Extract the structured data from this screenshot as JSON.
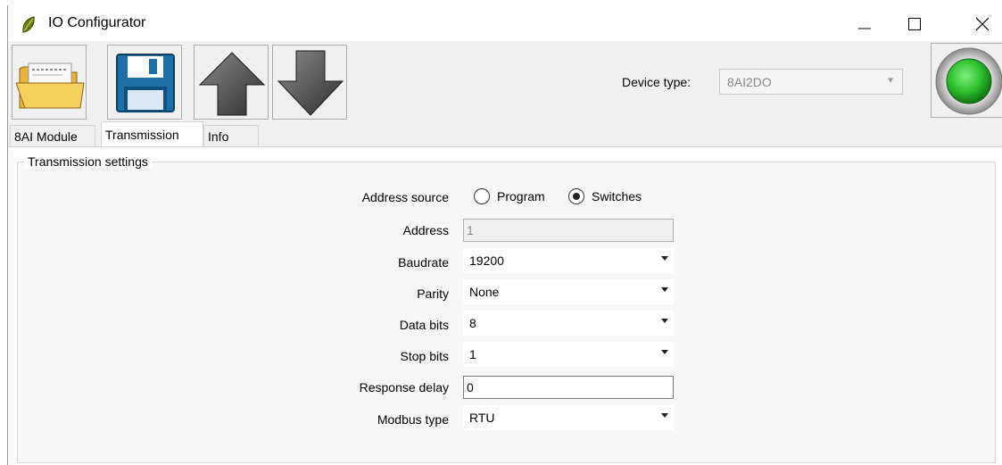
{
  "window": {
    "title": "IO Configurator"
  },
  "toolbar": {
    "buttons": [
      {
        "name": "open-button",
        "icon": "folder-icon"
      },
      {
        "name": "save-button",
        "icon": "floppy-disk-icon"
      },
      {
        "name": "upload-button",
        "icon": "arrow-up-icon"
      },
      {
        "name": "download-button",
        "icon": "arrow-down-icon"
      }
    ],
    "device_type_label": "Device type:",
    "device_type_value": "8AI2DO",
    "status_color": "#2fbf2f"
  },
  "tabs": [
    {
      "label": "8AI Module",
      "active": false
    },
    {
      "label": "Transmission",
      "active": true
    },
    {
      "label": "Info",
      "active": false
    }
  ],
  "transmission": {
    "group_title": "Transmission settings",
    "address_source": {
      "label": "Address source",
      "options": [
        "Program",
        "Switches"
      ],
      "selected": "Switches"
    },
    "address": {
      "label": "Address",
      "value": "1"
    },
    "baudrate": {
      "label": "Baudrate",
      "value": "19200"
    },
    "parity": {
      "label": "Parity",
      "value": "None"
    },
    "data_bits": {
      "label": "Data bits",
      "value": "8"
    },
    "stop_bits": {
      "label": "Stop bits",
      "value": "1"
    },
    "response_delay": {
      "label": "Response delay",
      "value": "0"
    },
    "modbus_type": {
      "label": "Modbus type",
      "value": "RTU"
    }
  }
}
